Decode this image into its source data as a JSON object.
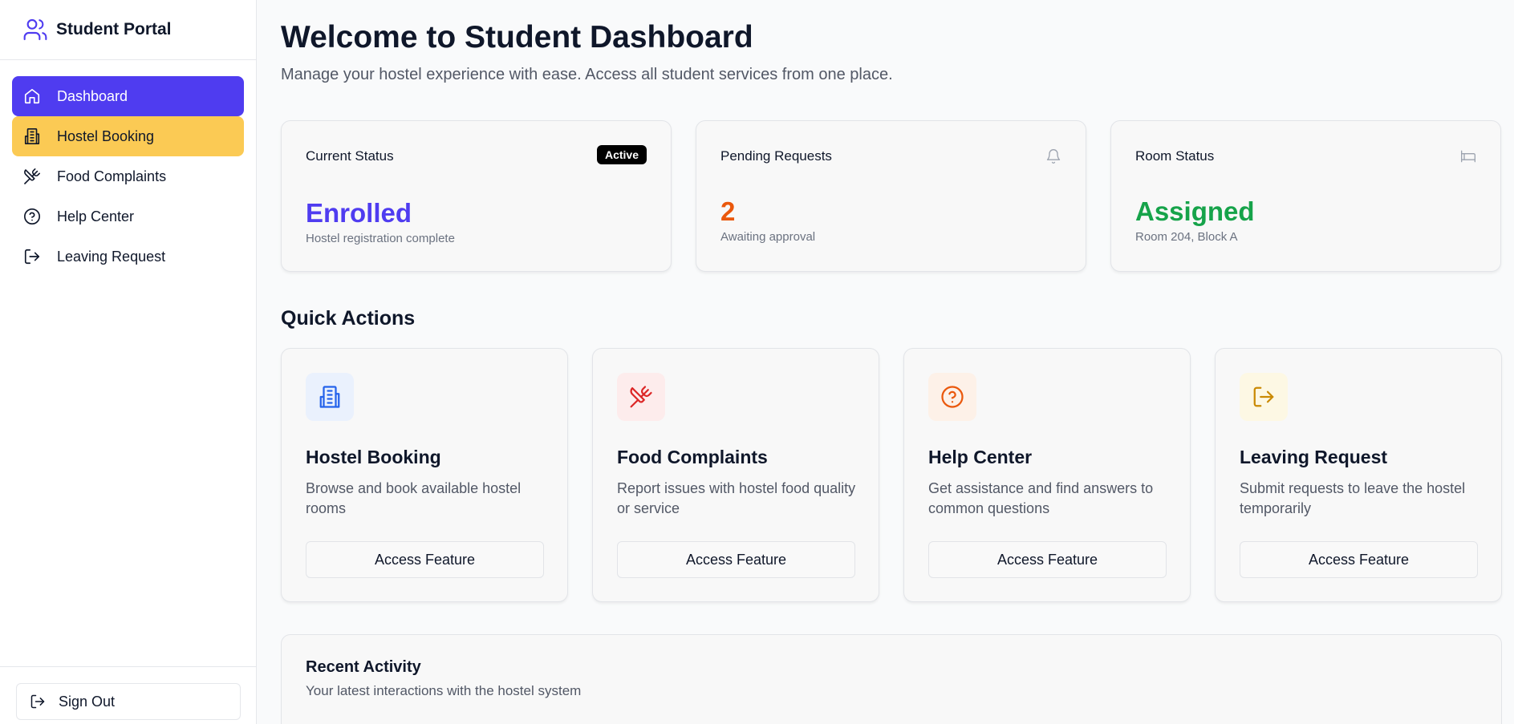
{
  "sidebar": {
    "brand": "Student Portal",
    "items": [
      {
        "label": "Dashboard",
        "icon": "home-icon"
      },
      {
        "label": "Hostel Booking",
        "icon": "building-icon"
      },
      {
        "label": "Food Complaints",
        "icon": "utensils-crossed-icon"
      },
      {
        "label": "Help Center",
        "icon": "help-circle-icon"
      },
      {
        "label": "Leaving Request",
        "icon": "log-out-icon"
      }
    ],
    "signout": "Sign Out"
  },
  "header": {
    "title": "Welcome to Student Dashboard",
    "subtitle": "Manage your hostel experience with ease. Access all student services from one place."
  },
  "status_cards": [
    {
      "label": "Current Status",
      "badge": "Active",
      "value": "Enrolled",
      "note": "Hostel registration complete",
      "color": "#4f3cf0"
    },
    {
      "label": "Pending Requests",
      "icon": "bell-icon",
      "value": "2",
      "note": "Awaiting approval",
      "color": "#ea580c"
    },
    {
      "label": "Room Status",
      "icon": "bed-icon",
      "value": "Assigned",
      "note": "Room 204, Block A",
      "color": "#16a34a"
    }
  ],
  "quick_actions": {
    "title": "Quick Actions",
    "cards": [
      {
        "title": "Hostel Booking",
        "desc": "Browse and book available hostel rooms",
        "button": "Access Feature",
        "icon": "building-icon",
        "icon_color": "#2563eb",
        "bg": "#eaf1fd"
      },
      {
        "title": "Food Complaints",
        "desc": "Report issues with hostel food quality or service",
        "button": "Access Feature",
        "icon": "utensils-crossed-icon",
        "icon_color": "#dc2626",
        "bg": "#fdecec"
      },
      {
        "title": "Help Center",
        "desc": "Get assistance and find answers to common questions",
        "button": "Access Feature",
        "icon": "help-circle-icon",
        "icon_color": "#ea580c",
        "bg": "#fdf1e8"
      },
      {
        "title": "Leaving Request",
        "desc": "Submit requests to leave the hostel temporarily",
        "button": "Access Feature",
        "icon": "log-out-icon",
        "icon_color": "#ca8a04",
        "bg": "#fdf8e4"
      }
    ]
  },
  "recent_activity": {
    "title": "Recent Activity",
    "subtitle": "Your latest interactions with the hostel system"
  }
}
